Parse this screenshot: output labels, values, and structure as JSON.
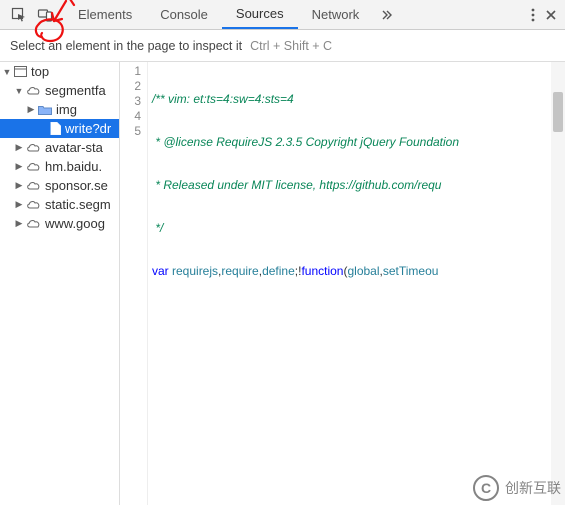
{
  "toolbar": {
    "tabs": {
      "elements": "Elements",
      "console": "Console",
      "sources": "Sources",
      "network": "Network"
    }
  },
  "tooltip": {
    "text": "Select an element in the page to inspect it",
    "shortcut": "Ctrl + Shift + C"
  },
  "tree": {
    "top": "top",
    "segmentfa": "segmentfa",
    "img": "img",
    "write": "write?dr",
    "avatar": "avatar-sta",
    "hm": "hm.baidu.",
    "sponsor": "sponsor.se",
    "static": "static.segm",
    "wwwgoog": "www.goog"
  },
  "gutter": {
    "l1": "1",
    "l2": "2",
    "l3": "3",
    "l4": "4",
    "l5": "5"
  },
  "code": {
    "line1": "/** vim: et:ts=4:sw=4:sts=4",
    "line2": " * @license RequireJS 2.3.5 Copyright jQuery Foundation",
    "line3": " * Released under MIT license, https://github.com/requ",
    "line4": " */",
    "line5_var": "var",
    "line5_req": " requirejs",
    "line5_p1": ",",
    "line5_require": "require",
    "line5_p2": ",",
    "line5_define": "define",
    "line5_p3": ";!",
    "line5_function": "function",
    "line5_p4": "(",
    "line5_global": "global",
    "line5_p5": ",",
    "line5_settimeout": "setTimeou"
  },
  "watermark": {
    "logo": "C",
    "text": "创新互联"
  }
}
